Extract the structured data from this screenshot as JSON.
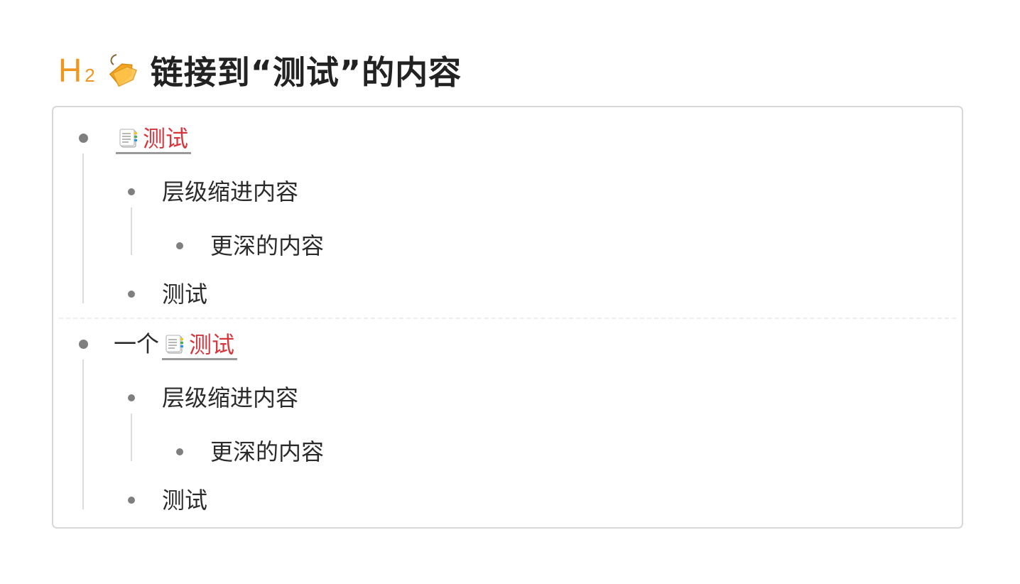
{
  "heading": {
    "level_letter": "H",
    "level_number": "2",
    "icon": "tag-icon",
    "title": "链接到“测试”的内容"
  },
  "groups": [
    {
      "prefix": "",
      "link": {
        "icon": "document-icon",
        "label": "测试"
      },
      "children": [
        {
          "label": "层级缩进内容",
          "children": [
            {
              "label": "更深的内容"
            }
          ]
        },
        {
          "label": "测试"
        }
      ]
    },
    {
      "prefix": "一个",
      "link": {
        "icon": "document-icon",
        "label": "测试"
      },
      "children": [
        {
          "label": "层级缩进内容",
          "children": [
            {
              "label": "更深的内容"
            }
          ]
        },
        {
          "label": "测试"
        }
      ]
    }
  ],
  "colors": {
    "heading_marker": "#f0961e",
    "link_text": "#d8343c",
    "bullet": "#7f7f7f",
    "guide_line": "#dcdcdc",
    "panel_border": "#d8d8d8"
  }
}
